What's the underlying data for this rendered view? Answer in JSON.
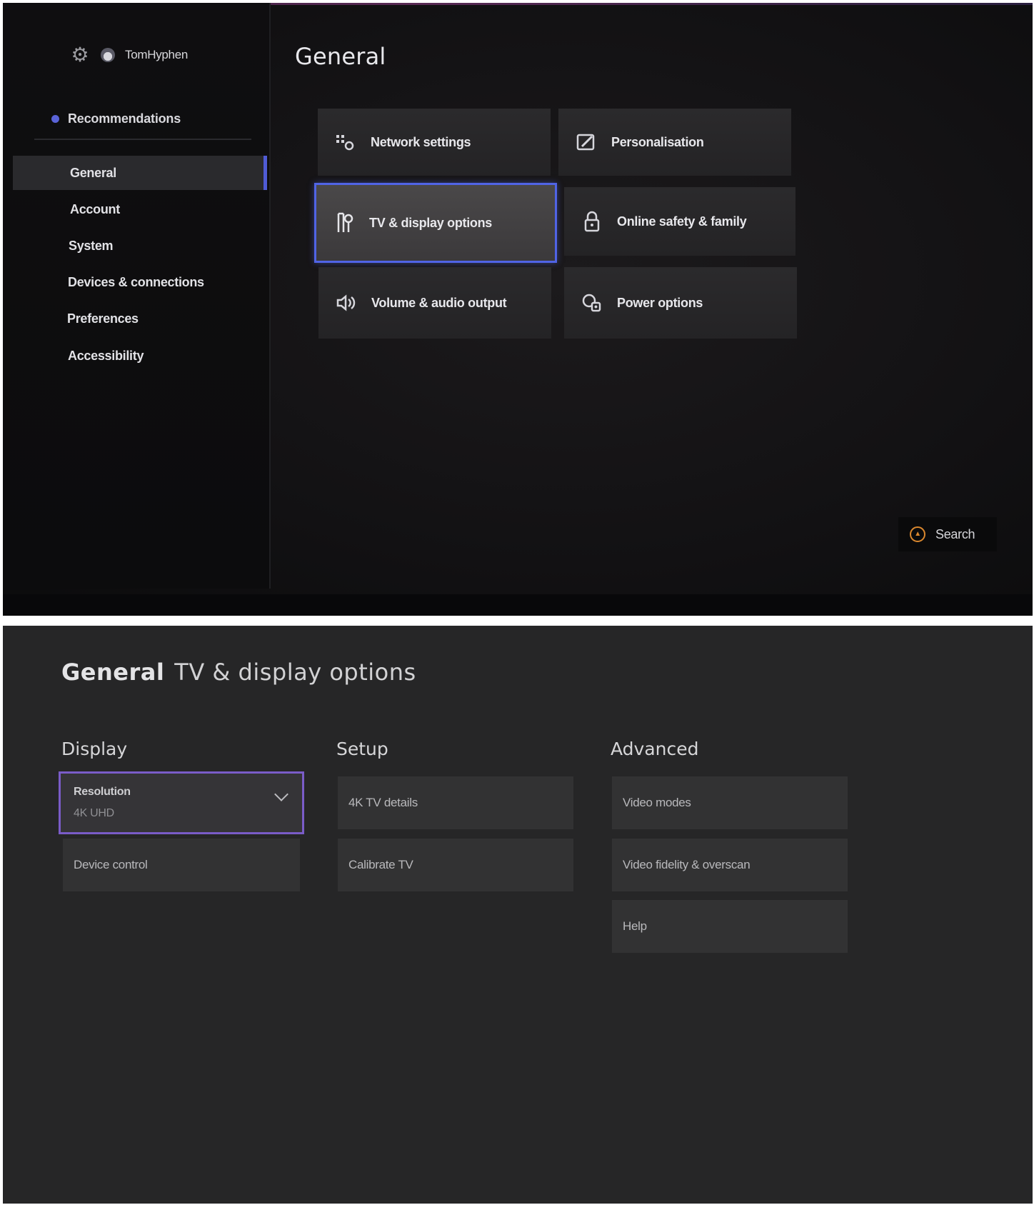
{
  "top": {
    "profile": {
      "username": "TomHyphen"
    },
    "sidebar": {
      "recommendations_label": "Recommendations",
      "items": [
        {
          "label": "General"
        },
        {
          "label": "Account"
        },
        {
          "label": "System"
        },
        {
          "label": "Devices & connections"
        },
        {
          "label": "Preferences"
        },
        {
          "label": "Accessibility"
        }
      ]
    },
    "page_title": "General",
    "tiles": [
      {
        "label": "Network settings",
        "icon": "network-icon"
      },
      {
        "label": "Personalisation",
        "icon": "personalisation-icon"
      },
      {
        "label": "TV & display options",
        "icon": "tv-display-icon"
      },
      {
        "label": "Online safety & family",
        "icon": "lock-icon"
      },
      {
        "label": "Volume & audio output",
        "icon": "speaker-icon"
      },
      {
        "label": "Power options",
        "icon": "power-icon"
      }
    ],
    "search_label": "Search"
  },
  "bottom": {
    "title_primary": "General",
    "title_secondary": "TV & display options",
    "display": {
      "heading": "Display",
      "resolution_label": "Resolution",
      "resolution_value": "4K UHD",
      "device_control_label": "Device control"
    },
    "setup": {
      "heading": "Setup",
      "items": [
        "4K TV details",
        "Calibrate TV"
      ]
    },
    "advanced": {
      "heading": "Advanced",
      "items": [
        "Video modes",
        "Video fidelity & overscan",
        "Help"
      ]
    }
  },
  "colors": {
    "focus_blue": "#5064e6",
    "focus_purple": "#7a5cc8",
    "accent_dot": "#5a63d8",
    "search_orange": "#d9872e"
  }
}
